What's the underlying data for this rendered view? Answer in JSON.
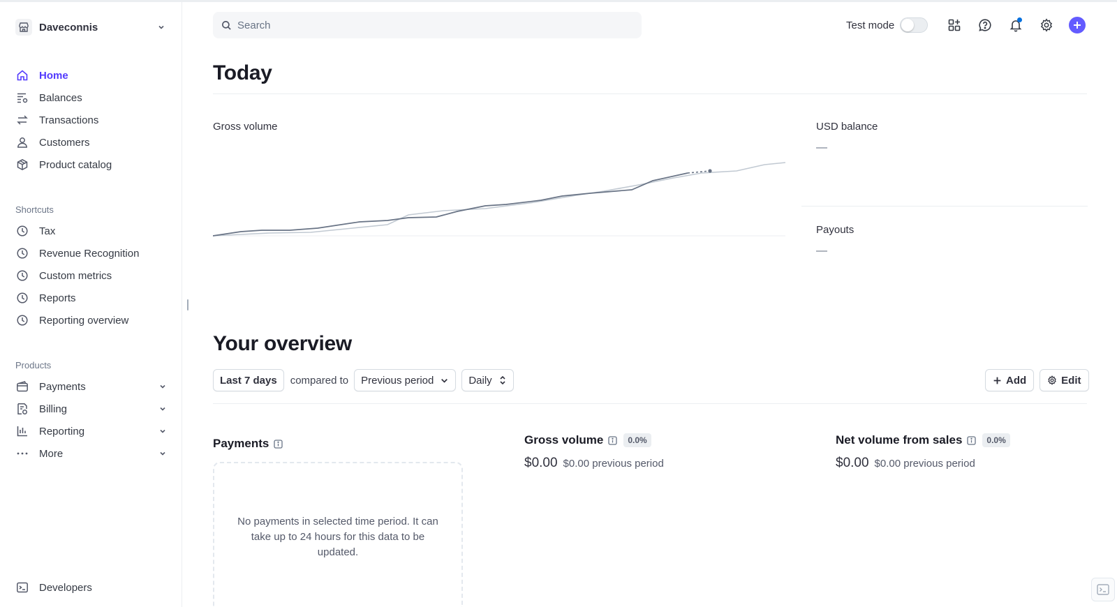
{
  "account": {
    "name": "Daveconnis"
  },
  "nav": {
    "main": [
      {
        "label": "Home",
        "icon": "home-icon",
        "active": true
      },
      {
        "label": "Balances",
        "icon": "balances-icon"
      },
      {
        "label": "Transactions",
        "icon": "transactions-icon"
      },
      {
        "label": "Customers",
        "icon": "customers-icon"
      },
      {
        "label": "Product catalog",
        "icon": "product-catalog-icon"
      }
    ],
    "shortcuts_title": "Shortcuts",
    "shortcuts": [
      {
        "label": "Tax",
        "icon": "clock-icon"
      },
      {
        "label": "Revenue Recognition",
        "icon": "clock-icon"
      },
      {
        "label": "Custom metrics",
        "icon": "clock-icon"
      },
      {
        "label": "Reports",
        "icon": "clock-icon"
      },
      {
        "label": "Reporting overview",
        "icon": "clock-icon"
      }
    ],
    "products_title": "Products",
    "products": [
      {
        "label": "Payments",
        "icon": "payments-icon"
      },
      {
        "label": "Billing",
        "icon": "billing-icon"
      },
      {
        "label": "Reporting",
        "icon": "reporting-icon"
      },
      {
        "label": "More",
        "icon": "more-icon"
      }
    ],
    "developers": {
      "label": "Developers",
      "icon": "terminal-icon"
    }
  },
  "header": {
    "search_placeholder": "Search",
    "test_mode_label": "Test mode",
    "test_mode_on": false,
    "icons": [
      "apps-icon",
      "help-icon",
      "notifications-icon",
      "settings-icon",
      "create-icon"
    ]
  },
  "today": {
    "title": "Today",
    "gross_volume_label": "Gross volume",
    "usd_balance_label": "USD balance",
    "usd_balance_value": "—",
    "payouts_label": "Payouts",
    "payouts_value": "—"
  },
  "overview": {
    "title": "Your overview",
    "range": "Last 7 days",
    "compared_to": "compared to",
    "comparison": "Previous period",
    "interval": "Daily",
    "add_label": "Add",
    "edit_label": "Edit",
    "payments": {
      "title": "Payments",
      "empty_text": "No payments in selected time period. It can take up to 24 hours for this data to be updated."
    },
    "gross_volume": {
      "title": "Gross volume",
      "change": "0.0%",
      "value": "$0.00",
      "previous": "$0.00 previous period"
    },
    "net_volume": {
      "title": "Net volume from sales",
      "change": "0.0%",
      "value": "$0.00",
      "previous": "$0.00 previous period"
    }
  },
  "colors": {
    "accent": "#533afd",
    "create_button": "#635bff",
    "notification_dot": "#0570de"
  }
}
